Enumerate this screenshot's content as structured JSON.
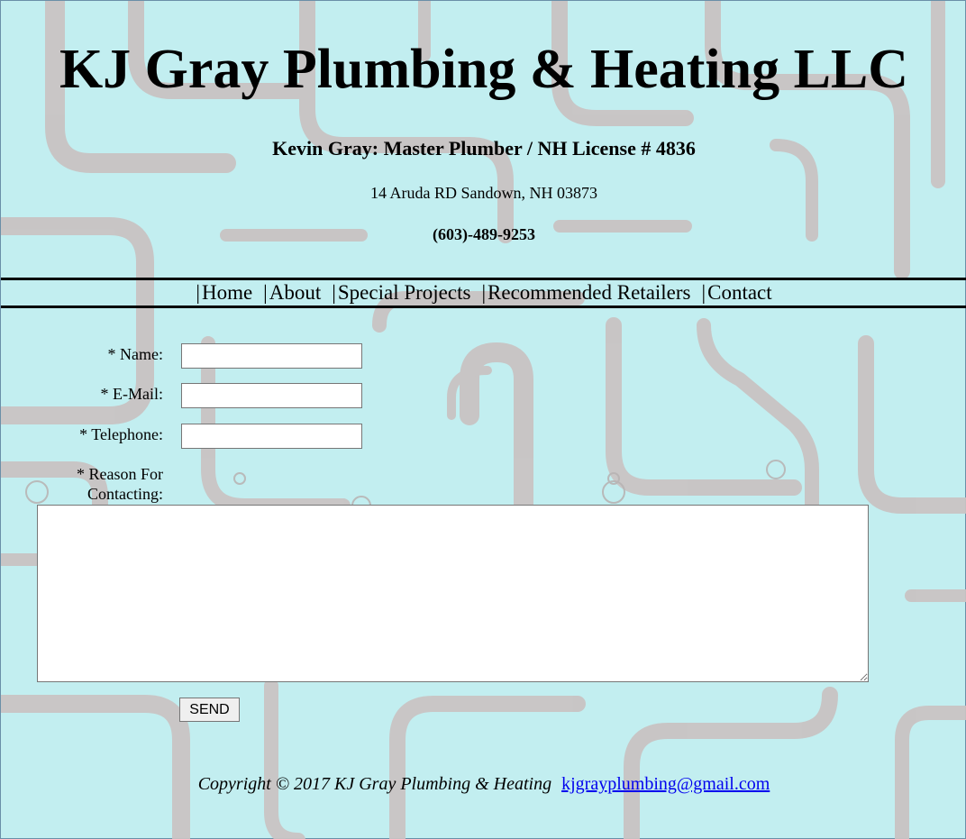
{
  "header": {
    "title": "KJ Gray Plumbing & Heating LLC",
    "subtitle": "Kevin Gray: Master Plumber / NH License # 4836",
    "address": "14 Aruda RD Sandown, NH 03873",
    "phone": "(603)-489-9253"
  },
  "nav": {
    "separator": "|",
    "items": [
      {
        "label": "Home"
      },
      {
        "label": "About"
      },
      {
        "label": "Special Projects"
      },
      {
        "label": "Recommended Retailers"
      },
      {
        "label": "Contact"
      }
    ]
  },
  "form": {
    "name_label": "* Name:",
    "name_value": "",
    "email_label": "* E-Mail:",
    "email_value": "",
    "telephone_label": "* Telephone:",
    "telephone_value": "",
    "reason_label_line1": "* Reason For",
    "reason_label_line2": "Contacting:",
    "reason_value": "",
    "send_label": "SEND"
  },
  "footer": {
    "copyright": "Copyright © 2017 KJ Gray Plumbing & Heating",
    "email": "kjgrayplumbing@gmail.com"
  },
  "colors": {
    "background": "#c2eef0",
    "pipes": "#c9c3c3",
    "link": "#0000ee"
  }
}
